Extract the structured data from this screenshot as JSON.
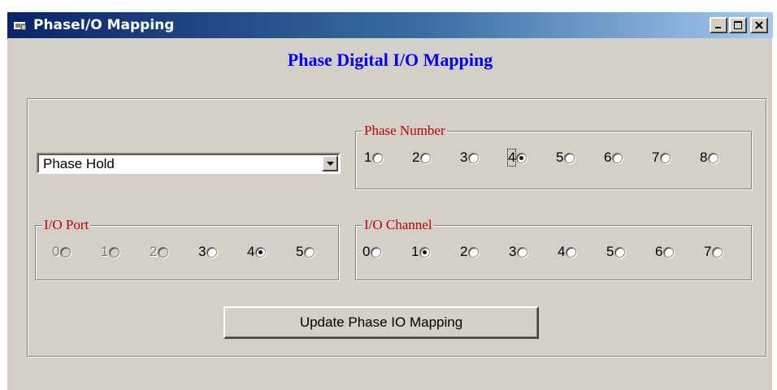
{
  "window": {
    "title": "PhaseI/O Mapping",
    "icon": "app-window-icon",
    "controls": [
      "minimize-icon",
      "maximize-icon",
      "close-icon"
    ]
  },
  "heading": "Phase Digital I/O Mapping",
  "dropdown": {
    "selected": "Phase Hold",
    "icon": "chevron-down-icon"
  },
  "phase_number": {
    "label": "Phase Number",
    "options": [
      "1",
      "2",
      "3",
      "4",
      "5",
      "6",
      "7",
      "8"
    ],
    "selected": "4",
    "focused": "4"
  },
  "io_port": {
    "label": "I/O Port",
    "options": [
      "0",
      "1",
      "2",
      "3",
      "4",
      "5"
    ],
    "disabled": [
      "0",
      "1",
      "2"
    ],
    "selected": "4"
  },
  "io_channel": {
    "label": "I/O Channel",
    "options": [
      "0",
      "1",
      "2",
      "3",
      "4",
      "5",
      "6",
      "7"
    ],
    "selected": "1"
  },
  "update_button": "Update Phase IO Mapping",
  "colors": {
    "heading": "#0000ff",
    "group_label": "#c00000",
    "face": "#d4d0c8",
    "titlebar_start": "#0a246a",
    "titlebar_end": "#a6caf0"
  }
}
